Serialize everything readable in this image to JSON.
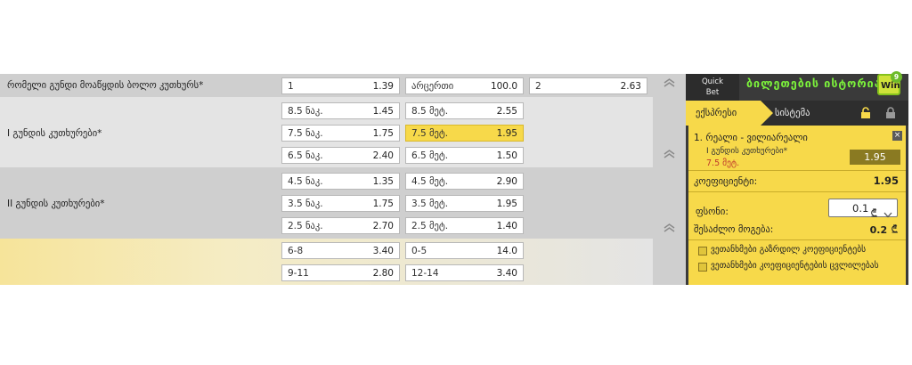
{
  "markets": [
    {
      "label": "რომელი გუნდი მოაწყდის ბოლო კუთხურს*",
      "odds": [
        {
          "label": "1",
          "value": "1.39"
        },
        {
          "label": "არცერთი",
          "value": "100.0"
        },
        {
          "label": "2",
          "value": "2.63"
        }
      ]
    },
    {
      "label": "I გუნდის კუთხურები*",
      "odds": [
        {
          "label": "8.5 ნაკ.",
          "value": "1.45"
        },
        {
          "label": "8.5 მეტ.",
          "value": "2.55"
        },
        {
          "label": "7.5 ნაკ.",
          "value": "1.75"
        },
        {
          "label": "7.5 მეტ.",
          "value": "1.95",
          "selected": true
        },
        {
          "label": "6.5 ნაკ.",
          "value": "2.40"
        },
        {
          "label": "6.5 მეტ.",
          "value": "1.50"
        }
      ]
    },
    {
      "label": "II გუნდის კუთხურები*",
      "odds": [
        {
          "label": "4.5 ნაკ.",
          "value": "1.35"
        },
        {
          "label": "4.5 მეტ.",
          "value": "2.90"
        },
        {
          "label": "3.5 ნაკ.",
          "value": "1.75"
        },
        {
          "label": "3.5 მეტ.",
          "value": "1.95"
        },
        {
          "label": "2.5 ნაკ.",
          "value": "2.70"
        },
        {
          "label": "2.5 მეტ.",
          "value": "1.40"
        }
      ]
    },
    {
      "label": "",
      "odds": [
        {
          "label": "6-8",
          "value": "3.40"
        },
        {
          "label": "0-5",
          "value": "14.0"
        },
        {
          "label": "9-11",
          "value": "2.80"
        },
        {
          "label": "12-14",
          "value": "3.40"
        }
      ]
    }
  ],
  "betslip": {
    "quick_bet_line1": "Quick",
    "quick_bet_line2": "Bet",
    "history_title": "ბილეთების ისტორია",
    "win_label": "Win",
    "win_badge": "9",
    "tab_express": "ექსპრესი",
    "tab_system": "სისტემა",
    "selection_title": "1. რეალი - ვილიარეალი",
    "selection_market": "I გუნდის კუთხურები*",
    "selection_pick": "7.5 მეტ.",
    "selection_odd": "1.95",
    "close_symbol": "×",
    "coef_label": "კოეფიციენტი:",
    "coef_value": "1.95",
    "stake_label": "ფსონი:",
    "stake_value": "0.1",
    "possible_win_label": "შესაძლო მოგება:",
    "possible_win_value": "0.2",
    "checkbox1": "ვეთანხმები გაზრდილ კოეფიციენტებს",
    "checkbox2": "ვეთანხმები კოეფიციენტების ცვლილებას"
  },
  "colors": {
    "accent_yellow": "#f7d94a",
    "history_green": "#7cf33b",
    "slip_dark": "#3a3a3a"
  },
  "icons": [
    "chevron-up-icon",
    "unlock-icon",
    "lock-icon",
    "close-icon",
    "lari-currency-icon",
    "chevron-down-icon"
  ]
}
